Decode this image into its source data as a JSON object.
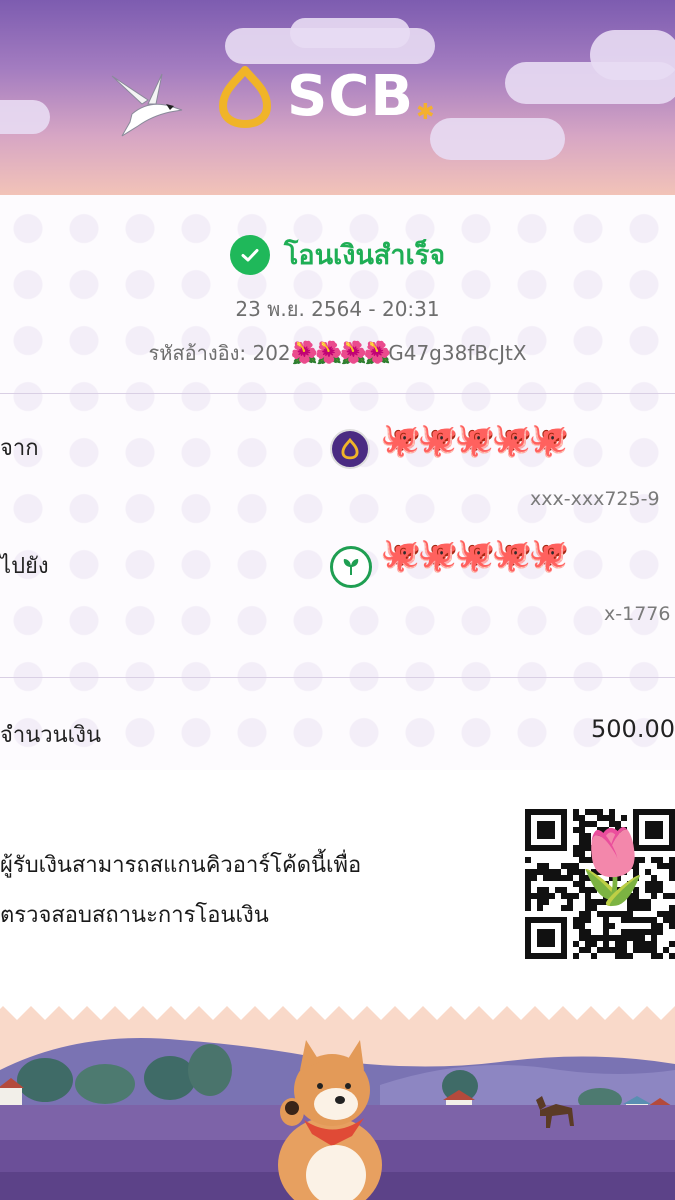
{
  "header": {
    "brand": "SCB",
    "colors": {
      "purple_top": "#7d5cb0",
      "peach_bottom": "#f2c3b8",
      "logo_gold": "#f0b428"
    }
  },
  "status": {
    "icon": "check-circle-icon",
    "text": "โอนเงินสำเร็จ",
    "color": "#1fae55"
  },
  "datetime": "23 พ.ย. 2564 - 20:31",
  "reference": {
    "prefix": "รหัสอ้างอิง: 202",
    "masked": "🌺🌺🌺🌺",
    "suffix": "G47g38fBcJtX"
  },
  "from": {
    "label": "จาก",
    "bank_icon": "scb-bank-icon",
    "name_masked": "🐙🐙🐙🐙🐙",
    "account": "xxx-xxx725-9"
  },
  "to": {
    "label": "ไปยัง",
    "bank_icon": "kbank-icon",
    "name_masked": "🐙🐙🐙🐙🐙",
    "account": "x-1776"
  },
  "amount": {
    "label": "จำนวนเงิน",
    "value": "500.00"
  },
  "qr_section": {
    "line1": "ผู้รับเงินสามารถสแกนคิวอาร์โค้ดนี้เพื่อ",
    "line2": "ตรวจสอบสถานะการโอนเงิน",
    "overlay_emoji": "🌷"
  }
}
